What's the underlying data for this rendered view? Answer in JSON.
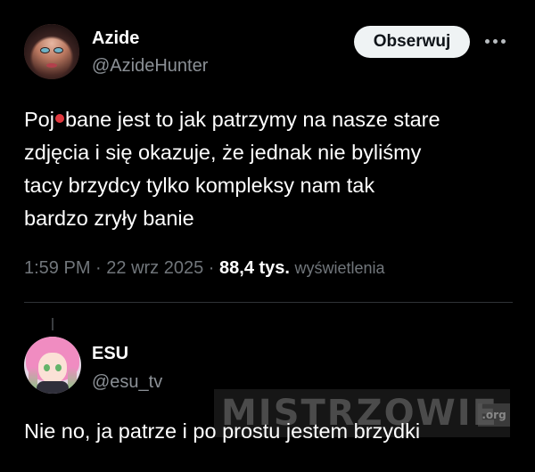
{
  "post": {
    "author": {
      "display_name": "Azide",
      "handle": "@AzideHunter",
      "avatar_icon": "avatar-woman-portrait"
    },
    "follow_button_label": "Obserwuj",
    "more_icon": "more-horizontal-icon",
    "text_lines": [
      [
        "Poj",
        "bane jest to jak patrzymy na nasze stare"
      ],
      "zdjęcia i się okazuje, że jednak nie byliśmy",
      "tacy brzydcy tylko kompleksy nam tak",
      "bardzo zryły banie"
    ],
    "censor_mark_color": "#e0383e",
    "meta": {
      "time": "1:59 PM",
      "separator": " · ",
      "date": "22 wrz 2025",
      "views_count": "88,4 tys.",
      "views_label": "wyświetlenia"
    }
  },
  "reply": {
    "author": {
      "display_name": "ESU",
      "handle": "@esu_tv",
      "avatar_icon": "avatar-anime-character"
    },
    "text": "Nie no, ja patrze i po prostu jestem brzydki"
  },
  "watermark": {
    "text": "MISTRZOWIE",
    "suffix": ".org"
  },
  "colors": {
    "background": "#000000",
    "primary_text": "#ffffff",
    "secondary_text": "#71767b",
    "follow_button_bg": "#eff3f4",
    "divider": "#2f3336"
  }
}
